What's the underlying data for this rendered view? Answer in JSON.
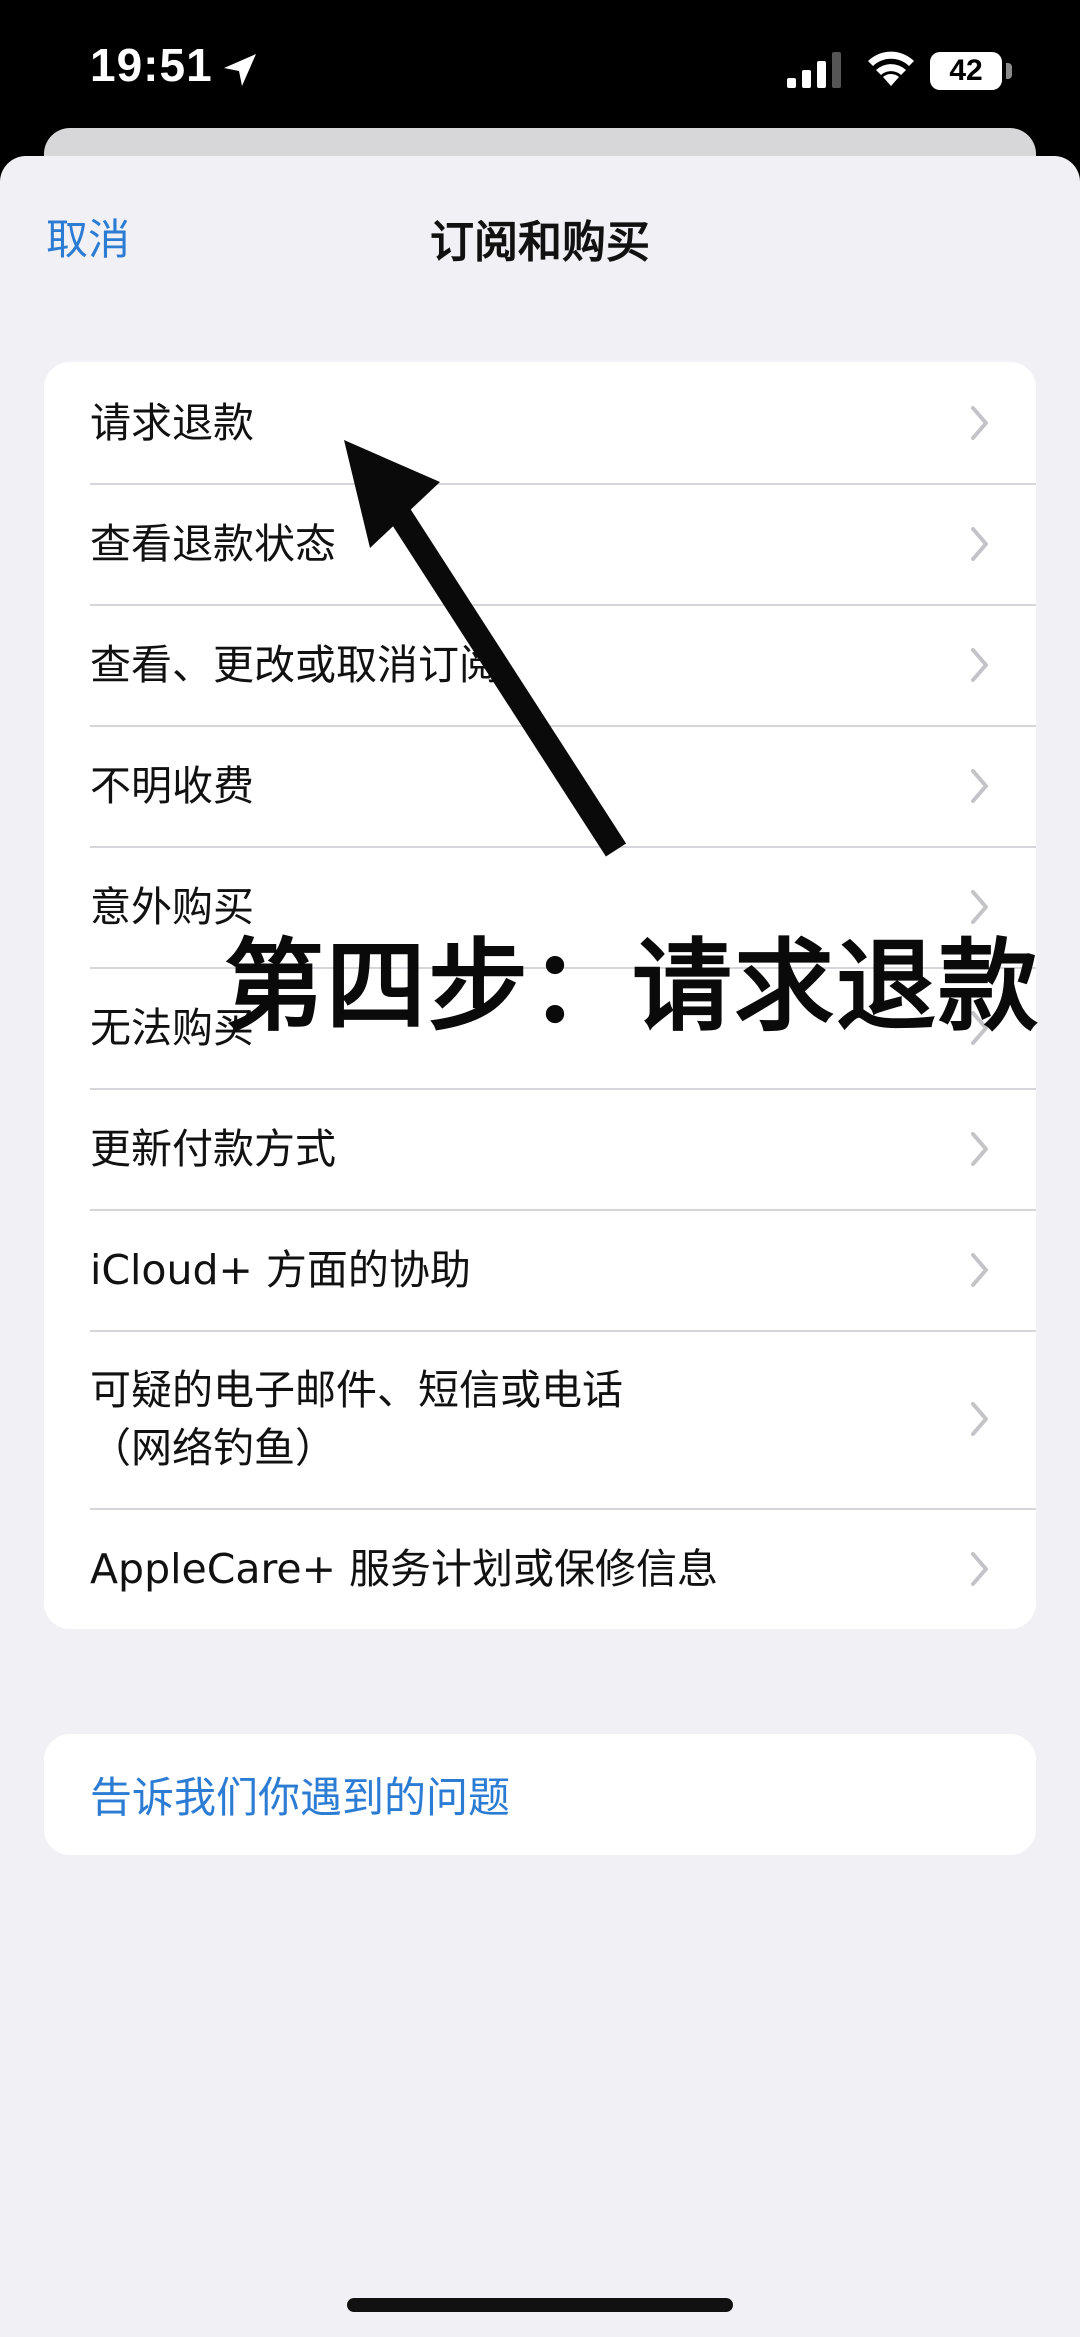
{
  "status": {
    "time": "19:51",
    "battery": "42",
    "icons": [
      "location-arrow-icon",
      "cellular-signal-icon",
      "wifi-icon",
      "battery-icon"
    ]
  },
  "nav": {
    "cancel": "取消",
    "title": "订阅和购买"
  },
  "menu": [
    {
      "label": "请求退款"
    },
    {
      "label": "查看退款状态"
    },
    {
      "label": "查看、更改或取消订阅"
    },
    {
      "label": "不明收费"
    },
    {
      "label": "意外购买"
    },
    {
      "label": "无法购买"
    },
    {
      "label": "更新付款方式"
    },
    {
      "label": "iCloud+ 方面的协助"
    },
    {
      "label": "可疑的电子邮件、短信或电话\n（网络钓鱼）"
    },
    {
      "label": "AppleCare+ 服务计划或保修信息"
    }
  ],
  "report": {
    "label": "告诉我们你遇到的问题"
  },
  "annotation": {
    "text": "第四步：请求退款"
  },
  "colors": {
    "accent": "#2c7cd4",
    "background": "#f1f1f5"
  }
}
